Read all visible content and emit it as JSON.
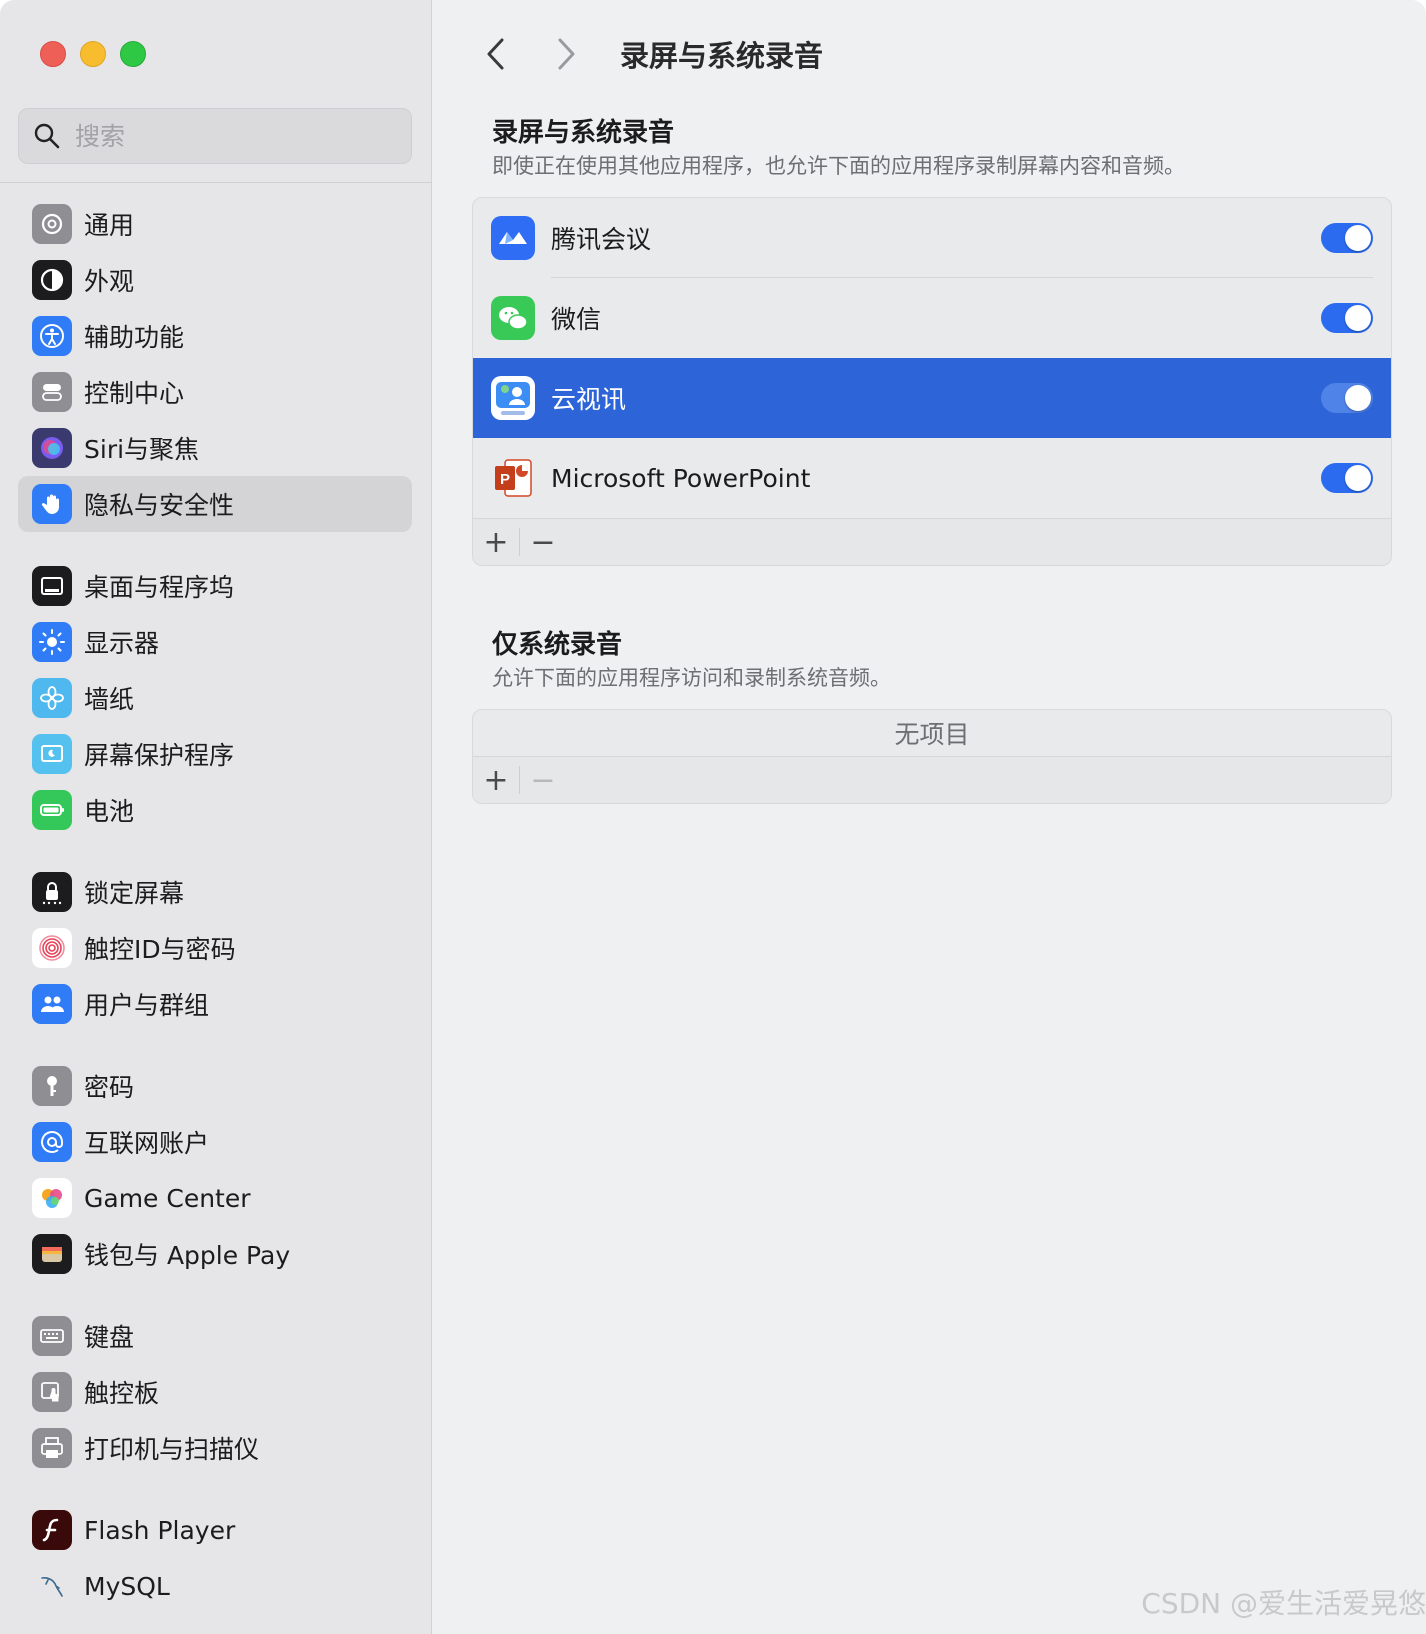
{
  "search": {
    "placeholder": "搜索"
  },
  "sidebar": {
    "groups": [
      [
        {
          "label": "通用",
          "icon": "gear-icon",
          "color": "#8e8e93"
        },
        {
          "label": "外观",
          "icon": "appearance-icon",
          "color": "#1c1c1e"
        },
        {
          "label": "辅助功能",
          "icon": "accessibility-icon",
          "color": "#2f7cf6"
        },
        {
          "label": "控制中心",
          "icon": "control-center-icon",
          "color": "#8e8e93"
        },
        {
          "label": "Siri与聚焦",
          "icon": "siri-icon",
          "color": "#3a3a6e"
        },
        {
          "label": "隐私与安全性",
          "icon": "hand-icon",
          "color": "#2f7cf6",
          "active": true
        }
      ],
      [
        {
          "label": "桌面与程序坞",
          "icon": "dock-icon",
          "color": "#1c1c1e"
        },
        {
          "label": "显示器",
          "icon": "sun-icon",
          "color": "#2f7cf6"
        },
        {
          "label": "墙纸",
          "icon": "flower-icon",
          "color": "#4fb8ee"
        },
        {
          "label": "屏幕保护程序",
          "icon": "screensaver-icon",
          "color": "#54c1ee"
        },
        {
          "label": "电池",
          "icon": "battery-icon",
          "color": "#34c759"
        }
      ],
      [
        {
          "label": "锁定屏幕",
          "icon": "lock-icon",
          "color": "#1c1c1e"
        },
        {
          "label": "触控ID与密码",
          "icon": "fingerprint-icon",
          "color": "#ffffff"
        },
        {
          "label": "用户与群组",
          "icon": "users-icon",
          "color": "#2f7cf6"
        }
      ],
      [
        {
          "label": "密码",
          "icon": "key-icon",
          "color": "#8e8e93"
        },
        {
          "label": "互联网账户",
          "icon": "at-icon",
          "color": "#2f7cf6"
        },
        {
          "label": "Game Center",
          "icon": "game-center-icon",
          "color": "#ffffff"
        },
        {
          "label": "钱包与 Apple Pay",
          "icon": "wallet-icon",
          "color": "#1c1c1e"
        }
      ],
      [
        {
          "label": "键盘",
          "icon": "keyboard-icon",
          "color": "#8e8e93"
        },
        {
          "label": "触控板",
          "icon": "trackpad-icon",
          "color": "#8e8e93"
        },
        {
          "label": "打印机与扫描仪",
          "icon": "printer-icon",
          "color": "#8e8e93"
        }
      ],
      [
        {
          "label": "Flash Player",
          "icon": "flash-icon",
          "color": "#3a0a0a"
        },
        {
          "label": "MySQL",
          "icon": "dolphin-icon",
          "color": "transparent"
        }
      ]
    ]
  },
  "header": {
    "title": "录屏与系统录音"
  },
  "screen_section": {
    "title": "录屏与系统录音",
    "subtitle": "即使正在使用其他应用程序，也允许下面的应用程序录制屏幕内容和音频。",
    "apps": [
      {
        "name": "腾讯会议",
        "icon": "tencent-meeting-icon",
        "enabled": true
      },
      {
        "name": "微信",
        "icon": "wechat-icon",
        "enabled": true
      },
      {
        "name": "云视讯",
        "icon": "cloud-video-icon",
        "enabled": true,
        "selected": true
      },
      {
        "name": "Microsoft PowerPoint",
        "icon": "powerpoint-icon",
        "enabled": true
      }
    ],
    "add_label": "+",
    "remove_label": "−"
  },
  "audio_section": {
    "title": "仅系统录音",
    "subtitle": "允许下面的应用程序访问和录制系统音频。",
    "empty_text": "无项目",
    "add_label": "+",
    "remove_label": "−"
  },
  "watermark": "CSDN @爱生活爱晃悠",
  "colors": {
    "accent": "#2b6bf0",
    "selection": "#2d64d8"
  }
}
